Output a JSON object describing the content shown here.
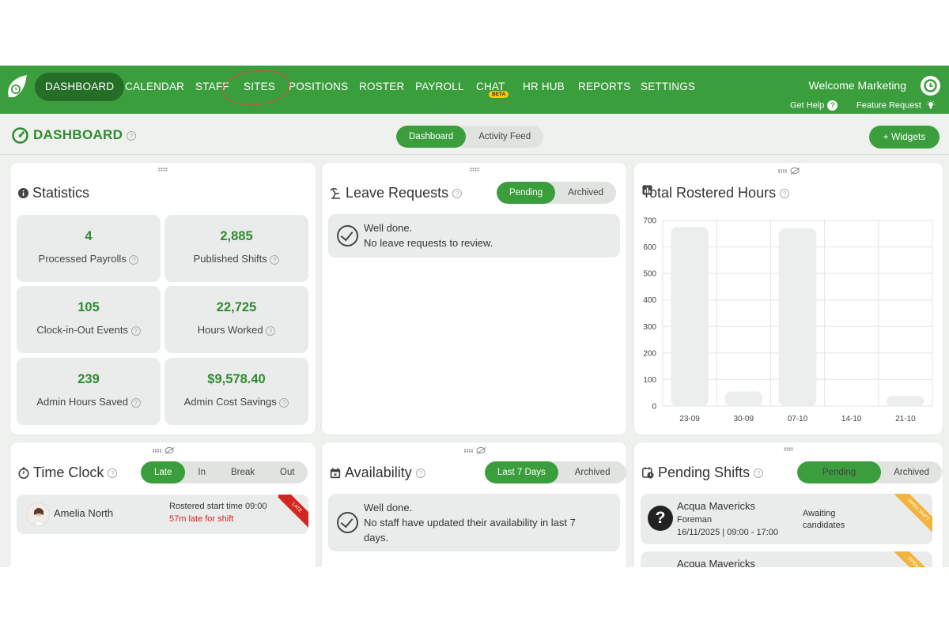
{
  "nav": {
    "items": [
      "DASHBOARD",
      "CALENDAR",
      "STAFF",
      "SITES",
      "POSITIONS",
      "ROSTER",
      "PAYROLL",
      "CHAT",
      "HR HUB",
      "REPORTS",
      "SETTINGS"
    ],
    "beta_badge": "BETA",
    "welcome": "Welcome Marketing",
    "get_help": "Get Help",
    "feature_request": "Feature Request",
    "accent_color": "#3a9e3d"
  },
  "header": {
    "title": "DASHBOARD",
    "tabs": [
      "Dashboard",
      "Activity Feed"
    ],
    "widgets_button": "+ Widgets"
  },
  "statistics": {
    "title": "Statistics",
    "items": [
      {
        "value": "4",
        "label": "Processed Payrolls"
      },
      {
        "value": "2,885",
        "label": "Published Shifts"
      },
      {
        "value": "105",
        "label": "Clock-in-Out Events"
      },
      {
        "value": "22,725",
        "label": "Hours Worked"
      },
      {
        "value": "239",
        "label": "Admin Hours Saved"
      },
      {
        "value": "$9,578.40",
        "label": "Admin Cost Savings"
      }
    ]
  },
  "leave_requests": {
    "title": "Leave Requests",
    "tabs": [
      "Pending",
      "Archived"
    ],
    "message_line1": "Well done.",
    "message_line2": "No leave requests to review."
  },
  "rostered_hours": {
    "title": "Total Rostered Hours"
  },
  "chart_data": {
    "type": "bar",
    "categories": [
      "23-09",
      "30-09",
      "07-10",
      "14-10",
      "21-10"
    ],
    "values": [
      675,
      55,
      670,
      0,
      38
    ],
    "ylim": [
      0,
      700
    ],
    "yticks": [
      0,
      100,
      200,
      300,
      400,
      500,
      600,
      700
    ],
    "grid": true,
    "bar_color": "#eceeed"
  },
  "time_clock": {
    "title": "Time Clock",
    "tabs": [
      "Late",
      "In",
      "Break",
      "Out"
    ],
    "entry": {
      "name": "Amelia North",
      "detail": "Rostered start time 09:00",
      "status": "57m late for shift",
      "ribbon": "LATE"
    }
  },
  "availability": {
    "title": "Availability",
    "tabs": [
      "Last 7 Days",
      "Archived"
    ],
    "message_line1": "Well done.",
    "message_line2": "No staff have updated their availability in last 7",
    "message_line3": "days."
  },
  "pending_shifts": {
    "title": "Pending Shifts",
    "tabs": [
      "Pending",
      "Archived"
    ],
    "badge_count": "2",
    "shifts": [
      {
        "site": "Acqua Mavericks",
        "position": "Foreman",
        "time": "16/11/2025 | 09:00 - 17:00",
        "status_line1": "Awaiting",
        "status_line2": "candidates",
        "ribbon": "OPEN SHIFT"
      },
      {
        "site": "Acqua Mavericks",
        "ribbon": "OPEN SHIFT"
      }
    ]
  }
}
